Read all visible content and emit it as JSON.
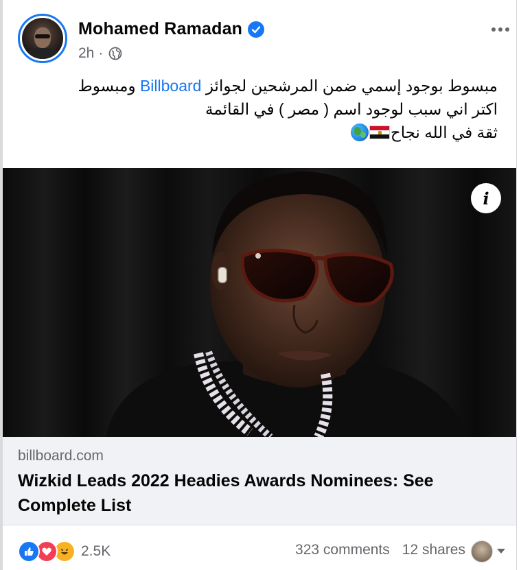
{
  "post": {
    "author": "Mohamed Ramadan",
    "time": "2h",
    "separator": "·",
    "more_icon": "more-horizontal-icon",
    "text_line1_before": "مبسوط بوجود إسمي ضمن المرشحين لجوائز ",
    "text_line1_link": "Billboard",
    "text_line1_after": " ومبسوط",
    "text_line2": "اكتر اني سبب لوجود اسم ( مصر ) في القائمة",
    "text_line3": "ثقة في الله نجاح"
  },
  "link_preview": {
    "domain": "billboard.com",
    "title": "Wizkid Leads 2022 Headies Awards Nominees: See Complete List"
  },
  "footer": {
    "reaction_count": "2.5K",
    "comments": "323 comments",
    "shares": "12 shares"
  },
  "colors": {
    "accent": "#1877f2",
    "love": "#f33e58",
    "haha": "#f7b125",
    "secondary_text": "#65676b"
  }
}
